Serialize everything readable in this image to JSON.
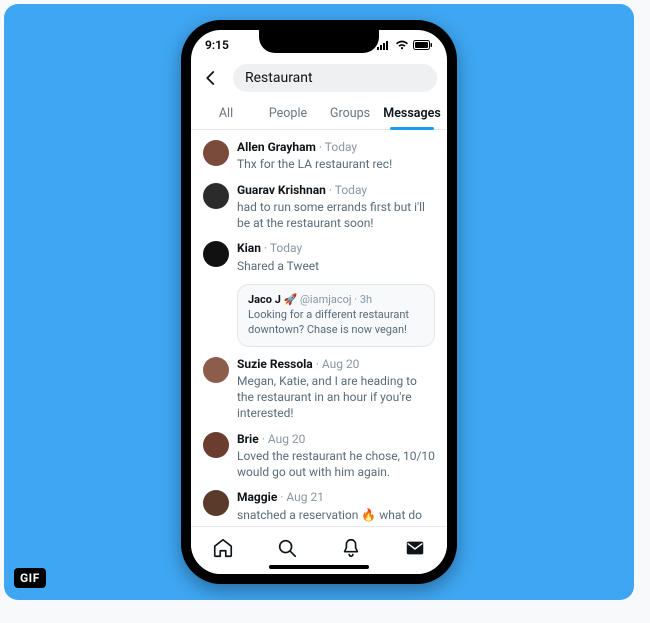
{
  "badge": {
    "gif": "GIF"
  },
  "status": {
    "time": "9:15"
  },
  "search": {
    "back_icon": "back",
    "query": "Restaurant"
  },
  "tabs": [
    {
      "label": "All",
      "active": false
    },
    {
      "label": "People",
      "active": false
    },
    {
      "label": "Groups",
      "active": false
    },
    {
      "label": "Messages",
      "active": true
    }
  ],
  "messages": [
    {
      "name": "Allen Grayham",
      "time": "Today",
      "text": "Thx for the LA restaurant rec!",
      "avatar_color": "#7a4a3a"
    },
    {
      "name": "Guarav Krishnan",
      "time": "Today",
      "text": "had to run some errands first but i'll be at the restaurant soon!",
      "avatar_color": "#2b2b2b"
    },
    {
      "name": "Kian",
      "time": "Today",
      "text": "Shared a Tweet",
      "avatar_color": "#111111",
      "embed": {
        "name": "Jaco J",
        "emoji": "🚀",
        "handle": "@iamjacoj",
        "etime": "3h",
        "text": "Looking for a different restaurant downtown? Chase is now vegan!"
      }
    },
    {
      "name": "Suzie Ressola",
      "time": "Aug 20",
      "text": "Megan, Katie, and I are heading to the restaurant in an hour if you're interested!",
      "avatar_color": "#8b5d4a"
    },
    {
      "name": "Brie",
      "time": "Aug 20",
      "text": "Loved the restaurant he chose, 10/10 would go out with him again.",
      "avatar_color": "#6b3d2e"
    },
    {
      "name": "Maggie",
      "time": "Aug 21",
      "text": "snatched a reservation 🔥 what do you think the restaurant's dress code is like?",
      "avatar_color": "#5a3a2a"
    }
  ],
  "bottom_nav": {
    "home": "home-icon",
    "search": "search-icon",
    "notifications": "bell-icon",
    "messages": "mail-icon"
  }
}
